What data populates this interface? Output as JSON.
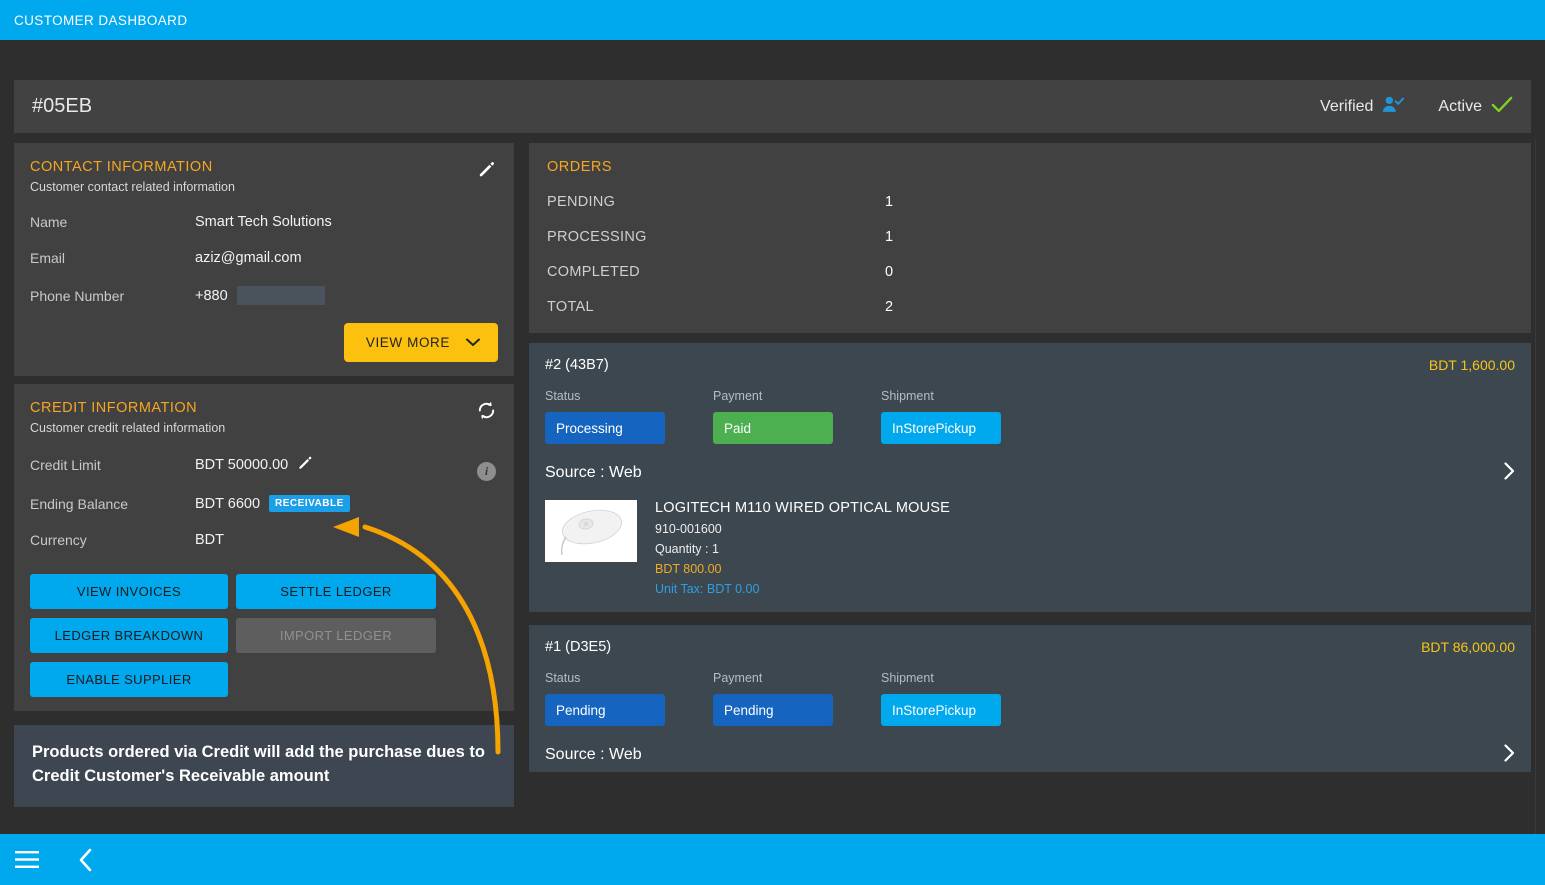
{
  "topbar": {
    "title": "CUSTOMER DASHBOARD"
  },
  "header": {
    "customer_id": "#05EB",
    "verified_label": "Verified",
    "verified_icon": "user-check-icon",
    "active_label": "Active",
    "active_icon": "check-icon"
  },
  "contact": {
    "title": "CONTACT INFORMATION",
    "subtitle": "Customer contact related information",
    "edit_icon": "pencil-icon",
    "fields": [
      {
        "label": "Name",
        "value": "Smart Tech Solutions"
      },
      {
        "label": "Email",
        "value": "aziz@gmail.com"
      },
      {
        "label": "Phone Number",
        "value": "+880"
      }
    ],
    "view_more_label": "VIEW MORE",
    "view_more_icon": "chevron-down-icon"
  },
  "credit": {
    "title": "CREDIT INFORMATION",
    "subtitle": "Customer credit related information",
    "refresh_icon": "refresh-icon",
    "info_icon": "info-icon",
    "credit_limit_label": "Credit Limit",
    "credit_limit_value": "BDT 50000.00",
    "credit_limit_edit_icon": "pencil-icon",
    "ending_balance_label": "Ending Balance",
    "ending_balance_value": "BDT 6600",
    "ending_balance_badge": "RECEIVABLE",
    "currency_label": "Currency",
    "currency_value": "BDT",
    "buttons": [
      {
        "label": "VIEW INVOICES",
        "disabled": false
      },
      {
        "label": "SETTLE LEDGER",
        "disabled": false
      },
      {
        "label": "LEDGER BREAKDOWN",
        "disabled": false
      },
      {
        "label": "IMPORT LEDGER",
        "disabled": true
      },
      {
        "label": "ENABLE SUPPLIER",
        "disabled": false
      }
    ]
  },
  "tooltip": {
    "text": "Products ordered via Credit will add the purchase dues to Credit Customer's Receivable amount"
  },
  "orders_summary": {
    "title": "ORDERS",
    "stats": [
      {
        "label": "PENDING",
        "value": "1"
      },
      {
        "label": "PROCESSING",
        "value": "1"
      },
      {
        "label": "COMPLETED",
        "value": "0"
      },
      {
        "label": "TOTAL",
        "value": "2"
      }
    ]
  },
  "orders": [
    {
      "code": "#2 (43B7)",
      "amount": "BDT 1,600.00",
      "status_label": "Status",
      "status_value": "Processing",
      "status_color": "blue",
      "payment_label": "Payment",
      "payment_value": "Paid",
      "payment_color": "green",
      "shipment_label": "Shipment",
      "shipment_value": "InStorePickup",
      "shipment_color": "cyan",
      "source": "Source : Web",
      "chevron_icon": "chevron-right-icon",
      "product": {
        "image_icon": "mouse-product-image",
        "name": "LOGITECH M110 WIRED OPTICAL MOUSE",
        "sku": "910-001600",
        "quantity": "Quantity : 1",
        "price": "BDT 800.00",
        "unit_tax": "Unit Tax: BDT 0.00"
      }
    },
    {
      "code": "#1 (D3E5)",
      "amount": "BDT 86,000.00",
      "status_label": "Status",
      "status_value": "Pending",
      "status_color": "blue",
      "payment_label": "Payment",
      "payment_value": "Pending",
      "payment_color": "blue",
      "shipment_label": "Shipment",
      "shipment_value": "InStorePickup",
      "shipment_color": "cyan",
      "source": "Source : Web",
      "chevron_icon": "chevron-right-icon"
    }
  ],
  "bottombar": {
    "menu_icon": "hamburger-menu-icon",
    "back_icon": "chevron-left-icon"
  },
  "colors": {
    "accent_blue": "#00a8ee",
    "accent_amber": "#f5a623",
    "annotation_orange": "#f5a300",
    "page_bg": "#2e2e2e",
    "panel_bg": "#414141",
    "order_card_bg": "#3c4750",
    "success_green": "#4caf50",
    "status_blue": "#1565c0"
  }
}
